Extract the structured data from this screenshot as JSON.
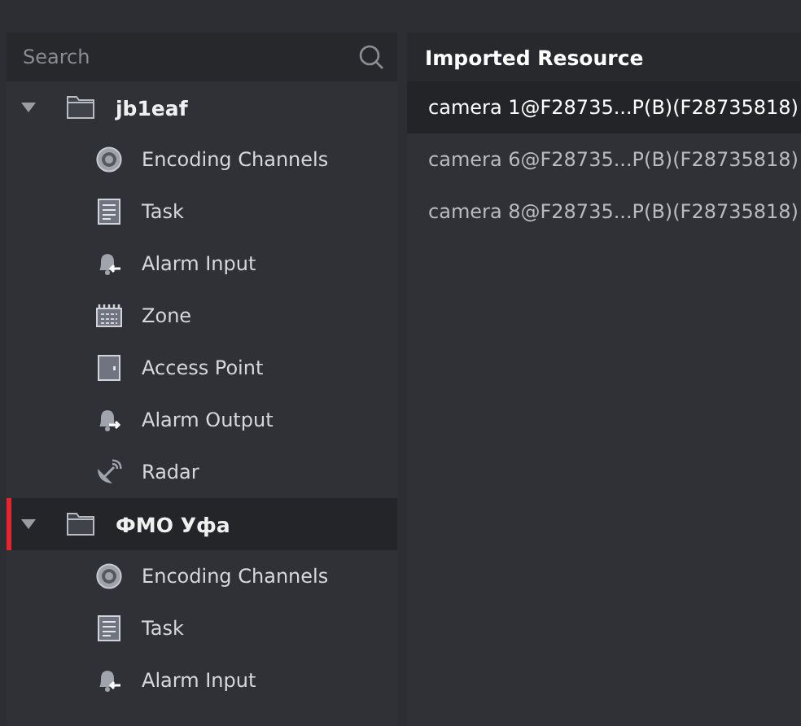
{
  "search": {
    "placeholder": "Search"
  },
  "tree": [
    {
      "label": "jb1eaf",
      "expanded": true,
      "selected": false,
      "children": [
        {
          "label": "Encoding Channels",
          "kind": "encoding"
        },
        {
          "label": "Task",
          "kind": "task"
        },
        {
          "label": "Alarm Input",
          "kind": "alarm-input"
        },
        {
          "label": "Zone",
          "kind": "zone"
        },
        {
          "label": "Access Point",
          "kind": "access-point"
        },
        {
          "label": "Alarm Output",
          "kind": "alarm-output"
        },
        {
          "label": "Radar",
          "kind": "radar"
        }
      ]
    },
    {
      "label": "ФМО Уфа",
      "expanded": true,
      "selected": true,
      "children": [
        {
          "label": "Encoding Channels",
          "kind": "encoding"
        },
        {
          "label": "Task",
          "kind": "task"
        },
        {
          "label": "Alarm Input",
          "kind": "alarm-input"
        }
      ]
    }
  ],
  "resources": {
    "title": "Imported Resource",
    "rows": [
      {
        "label": "camera 1@F28735...P(B)(F28735818)",
        "selected": true
      },
      {
        "label": "camera 6@F28735...P(B)(F28735818)",
        "selected": false
      },
      {
        "label": "camera 8@F28735...P(B)(F28735818)",
        "selected": false
      }
    ]
  }
}
